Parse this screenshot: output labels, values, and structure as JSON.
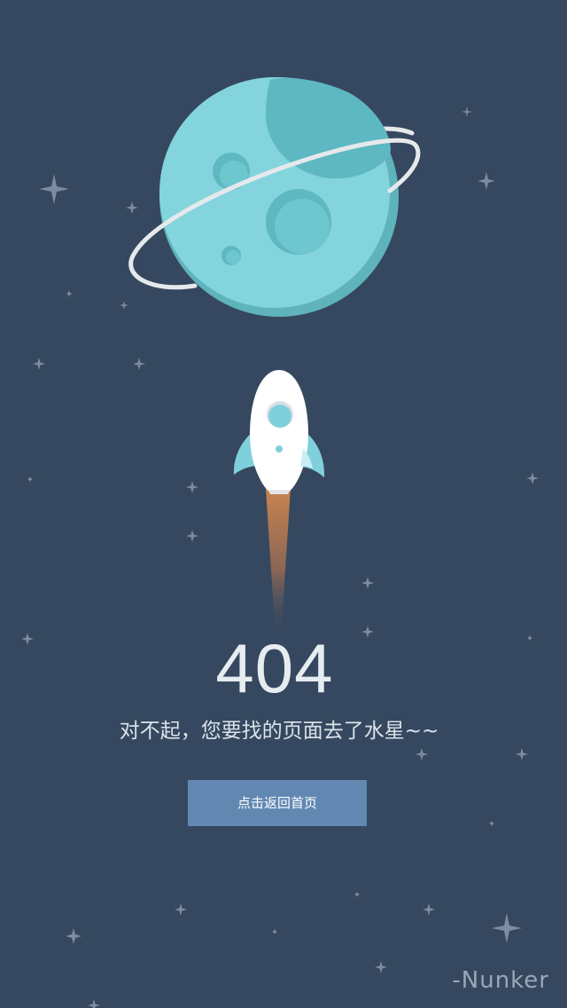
{
  "error": {
    "code": "404",
    "message": "对不起，您要找的页面去了水星~~"
  },
  "button": {
    "label": "点击返回首页"
  },
  "signature": {
    "text": "-Nunker"
  },
  "colors": {
    "background": "#35485f",
    "planet": "#82d3dd",
    "planet_shadow": "#5ab4bf",
    "button": "#6288b2",
    "rocket": "#ffffff",
    "flame": "#c4804f"
  },
  "illustration": {
    "planet_icon": "planet-with-ring-icon",
    "rocket_icon": "rocket-icon",
    "star_icon": "star-sparkle-icon"
  }
}
